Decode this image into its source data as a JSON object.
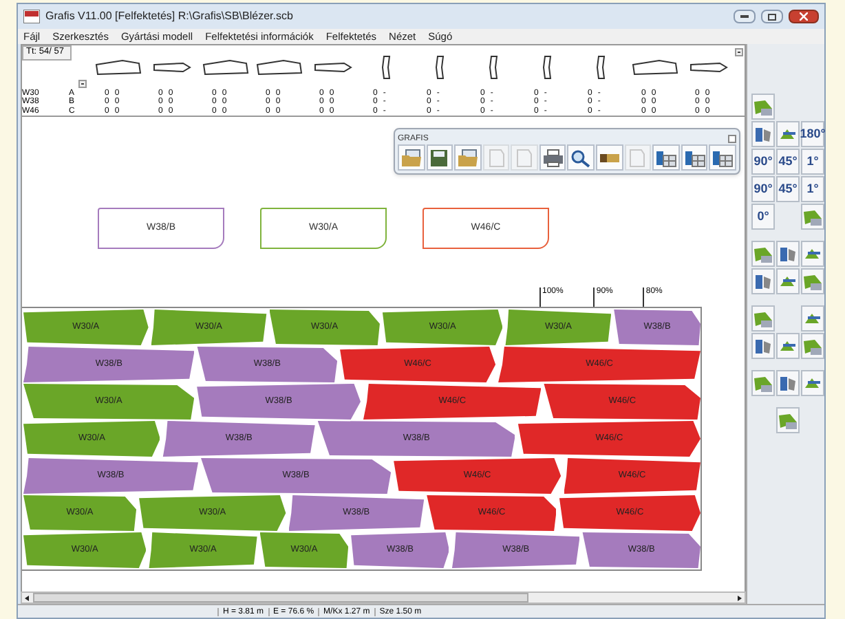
{
  "window": {
    "title": "Grafis V11.00 [Felfektetés] R:\\Grafis\\SB\\Blézer.scb"
  },
  "menu": [
    "Fájl",
    "Szerkesztés",
    "Gyártási modell",
    "Felfektetési információk",
    "Felfektetés",
    "Nézet",
    "Súgó"
  ],
  "piece_strip": {
    "counter": "Tt: 54/ 57",
    "rows": [
      {
        "size": "W30",
        "code": "A"
      },
      {
        "size": "W38",
        "code": "B"
      },
      {
        "size": "W46",
        "code": "C"
      }
    ],
    "columns": [
      {
        "kind": "wide",
        "counts": [
          [
            "0",
            "0"
          ],
          [
            "0",
            "0"
          ],
          [
            "0",
            "0"
          ]
        ]
      },
      {
        "kind": "narrow",
        "counts": [
          [
            "0",
            "0"
          ],
          [
            "0",
            "0"
          ],
          [
            "0",
            "0"
          ]
        ]
      },
      {
        "kind": "wide",
        "counts": [
          [
            "0",
            "0"
          ],
          [
            "0",
            "0"
          ],
          [
            "0",
            "0"
          ]
        ]
      },
      {
        "kind": "wide",
        "counts": [
          [
            "0",
            "0"
          ],
          [
            "0",
            "0"
          ],
          [
            "0",
            "0"
          ]
        ]
      },
      {
        "kind": "narrow",
        "counts": [
          [
            "0",
            "0"
          ],
          [
            "0",
            "0"
          ],
          [
            "0",
            "0"
          ]
        ]
      },
      {
        "kind": "sleeve",
        "counts": [
          [
            "0",
            "-"
          ],
          [
            "0",
            "-"
          ],
          [
            "0",
            "-"
          ]
        ]
      },
      {
        "kind": "sleeve",
        "counts": [
          [
            "0",
            "-"
          ],
          [
            "0",
            "-"
          ],
          [
            "0",
            "-"
          ]
        ]
      },
      {
        "kind": "sleeve",
        "counts": [
          [
            "0",
            "-"
          ],
          [
            "0",
            "-"
          ],
          [
            "0",
            "-"
          ]
        ]
      },
      {
        "kind": "sleeve",
        "counts": [
          [
            "0",
            "-"
          ],
          [
            "0",
            "-"
          ],
          [
            "0",
            "-"
          ]
        ]
      },
      {
        "kind": "sleeve",
        "counts": [
          [
            "0",
            "-"
          ],
          [
            "0",
            "-"
          ],
          [
            "0",
            "-"
          ]
        ]
      },
      {
        "kind": "wide",
        "counts": [
          [
            "0",
            "0"
          ],
          [
            "0",
            "0"
          ],
          [
            "0",
            "0"
          ]
        ]
      },
      {
        "kind": "narrow",
        "counts": [
          [
            "0",
            "0"
          ],
          [
            "0",
            "0"
          ],
          [
            "0",
            "0"
          ]
        ]
      }
    ]
  },
  "toolbar": {
    "title": "GRAFIS",
    "buttons": [
      {
        "kind": "open",
        "disabled": false
      },
      {
        "kind": "save",
        "disabled": false
      },
      {
        "kind": "open",
        "disabled": false
      },
      {
        "kind": "page",
        "disabled": true
      },
      {
        "kind": "page",
        "disabled": true
      },
      {
        "kind": "print",
        "disabled": false
      },
      {
        "kind": "zoom",
        "disabled": false
      },
      {
        "kind": "ruler",
        "disabled": false
      },
      {
        "kind": "page",
        "disabled": true
      },
      {
        "kind": "table",
        "disabled": false
      },
      {
        "kind": "table",
        "disabled": false
      },
      {
        "kind": "table",
        "disabled": false
      }
    ]
  },
  "preview_pieces": [
    {
      "label": "W38/B",
      "color": "#a57bbd"
    },
    {
      "label": "W30/A",
      "color": "#7fb33c"
    },
    {
      "label": "W46/C",
      "color": "#e8603c"
    }
  ],
  "efficiency_marks": [
    "100%",
    "90%",
    "80%"
  ],
  "marker_rows": [
    [
      {
        "label": "W30/A",
        "color": "#6aa628"
      },
      {
        "label": "W30/A",
        "color": "#6aa628"
      },
      {
        "label": "W30/A",
        "color": "#6aa628"
      },
      {
        "label": "W30/A",
        "color": "#6aa628"
      },
      {
        "label": "W30/A",
        "color": "#6aa628"
      },
      {
        "label": "W38/B",
        "color": "#a57bbd"
      }
    ],
    [
      {
        "label": "W38/B",
        "color": "#a57bbd"
      },
      {
        "label": "W38/B",
        "color": "#a57bbd"
      },
      {
        "label": "W46/C",
        "color": "#e02828"
      },
      {
        "label": "W46/C",
        "color": "#e02828"
      }
    ],
    [
      {
        "label": "W30/A",
        "color": "#6aa628"
      },
      {
        "label": "W38/B",
        "color": "#a57bbd"
      },
      {
        "label": "W46/C",
        "color": "#e02828"
      },
      {
        "label": "W46/C",
        "color": "#e02828"
      }
    ],
    [
      {
        "label": "W30/A",
        "color": "#6aa628"
      },
      {
        "label": "W38/B",
        "color": "#a57bbd"
      },
      {
        "label": "W38/B",
        "color": "#a57bbd"
      },
      {
        "label": "W46/C",
        "color": "#e02828"
      }
    ],
    [
      {
        "label": "W38/B",
        "color": "#a57bbd"
      },
      {
        "label": "W38/B",
        "color": "#a57bbd"
      },
      {
        "label": "W46/C",
        "color": "#e02828"
      },
      {
        "label": "W46/C",
        "color": "#e02828"
      }
    ],
    [
      {
        "label": "W30/A",
        "color": "#6aa628"
      },
      {
        "label": "W30/A",
        "color": "#6aa628"
      },
      {
        "label": "W38/B",
        "color": "#a57bbd"
      },
      {
        "label": "W46/C",
        "color": "#e02828"
      },
      {
        "label": "W46/C",
        "color": "#e02828"
      }
    ],
    [
      {
        "label": "W30/A",
        "color": "#6aa628"
      },
      {
        "label": "W30/A",
        "color": "#6aa628"
      },
      {
        "label": "W30/A",
        "color": "#6aa628"
      },
      {
        "label": "W38/B",
        "color": "#a57bbd"
      },
      {
        "label": "W38/B",
        "color": "#a57bbd"
      },
      {
        "label": "W38/B",
        "color": "#a57bbd"
      }
    ]
  ],
  "palette": [
    [
      {
        "kind": "tool"
      }
    ],
    [
      {
        "kind": "tool"
      },
      {
        "kind": "tool"
      },
      {
        "kind": "tool",
        "label": "180°"
      }
    ],
    [
      {
        "kind": "tool",
        "label": "90°"
      },
      {
        "kind": "tool",
        "label": "45°"
      },
      {
        "kind": "tool",
        "label": "1°"
      }
    ],
    [
      {
        "kind": "tool",
        "label": "90°"
      },
      {
        "kind": "tool",
        "label": "45°"
      },
      {
        "kind": "tool",
        "label": "1°"
      }
    ],
    [
      {
        "kind": "tool",
        "label": "0°"
      },
      {
        "kind": "gap"
      },
      {
        "kind": "tool"
      }
    ],
    [
      {
        "kind": "space"
      }
    ],
    [
      {
        "kind": "tool"
      },
      {
        "kind": "tool"
      },
      {
        "kind": "tool"
      }
    ],
    [
      {
        "kind": "tool"
      },
      {
        "kind": "tool"
      },
      {
        "kind": "tool"
      }
    ],
    [
      {
        "kind": "space"
      }
    ],
    [
      {
        "kind": "tool"
      },
      {
        "kind": "gap"
      },
      {
        "kind": "tool"
      }
    ],
    [
      {
        "kind": "tool"
      },
      {
        "kind": "tool"
      },
      {
        "kind": "tool"
      }
    ],
    [
      {
        "kind": "space"
      }
    ],
    [
      {
        "kind": "tool"
      },
      {
        "kind": "tool"
      },
      {
        "kind": "tool"
      }
    ],
    [
      {
        "kind": "space"
      }
    ],
    [
      {
        "kind": "gap"
      },
      {
        "kind": "tool"
      },
      {
        "kind": "gap"
      }
    ]
  ],
  "status_bar": [
    "H = 3.81 m",
    "E =  76.6 %",
    "M/Kx 1.27 m",
    "Sze 1.50 m"
  ]
}
